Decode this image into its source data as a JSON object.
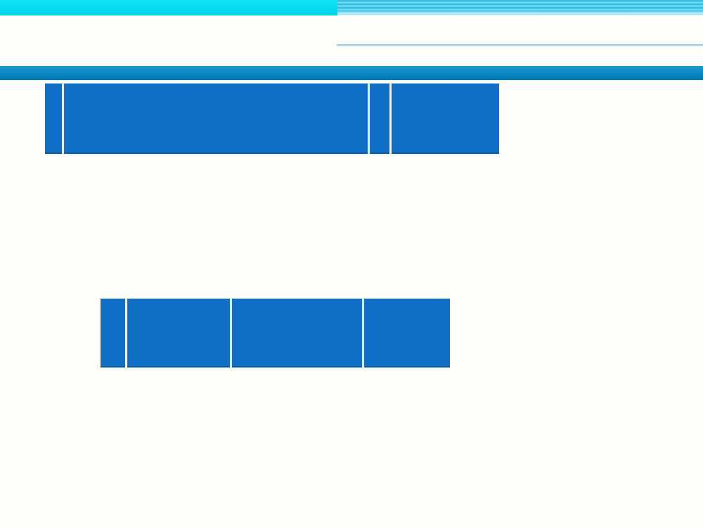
{
  "slide": {
    "header_colors": {
      "top_band_left": "#00D4EC",
      "top_band_right": "#1FB8E8",
      "title_bar": "#0A86BE",
      "table_cell": "#106FC6",
      "background": "#FDFEF9"
    },
    "title": "",
    "table_top": {
      "columns": 4,
      "rows": 1,
      "cells": [
        "",
        "",
        "",
        ""
      ]
    },
    "table_bottom": {
      "columns": 4,
      "rows": 1,
      "cells": [
        "",
        "",
        "",
        ""
      ]
    }
  }
}
